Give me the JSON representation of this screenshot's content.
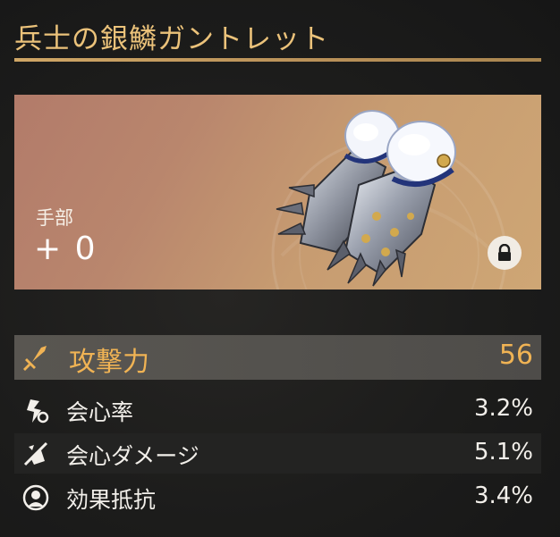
{
  "item": {
    "name": "兵士の銀鱗ガントレット",
    "slot": "手部",
    "level": "+ 0",
    "locked": true,
    "image_icon": "gauntlet-icon",
    "lock_icon": "lock-icon"
  },
  "main_stat": {
    "name": "攻撃力",
    "value": "56",
    "icon": "sword-icon"
  },
  "sub_stats": [
    {
      "name": "会心率",
      "value": "3.2%",
      "icon": "crit-rate-icon"
    },
    {
      "name": "会心ダメージ",
      "value": "5.1%",
      "icon": "crit-damage-icon"
    },
    {
      "name": "効果抵抗",
      "value": "3.4%",
      "icon": "effect-resistance-icon"
    }
  ],
  "colors": {
    "title": "#ebc27a",
    "accent": "#f0b354",
    "text": "#f2efea"
  }
}
